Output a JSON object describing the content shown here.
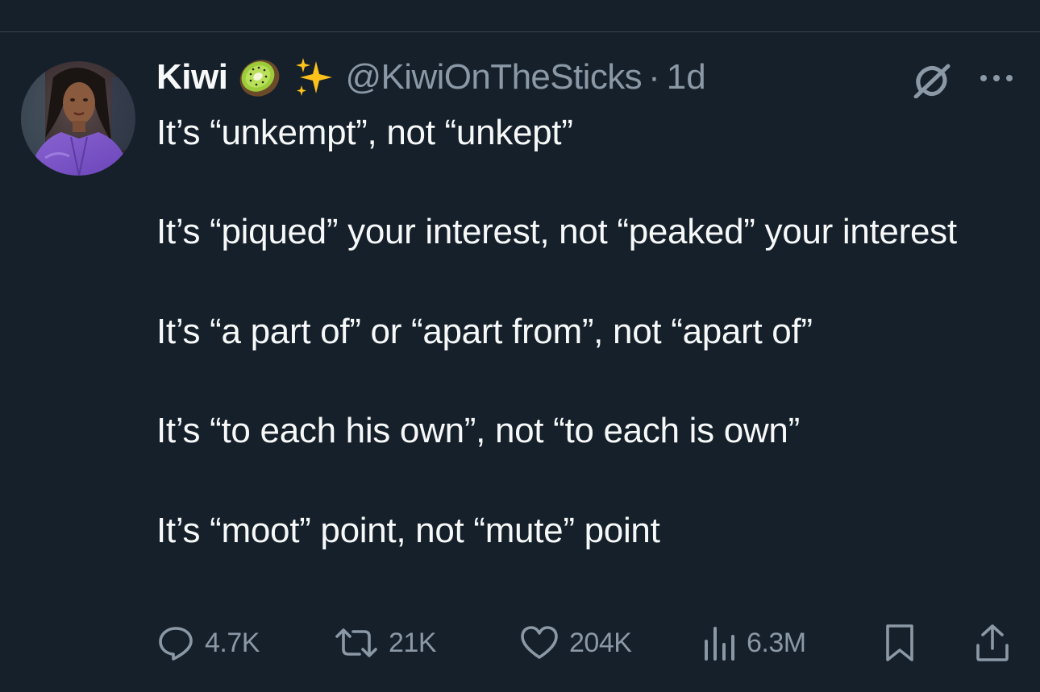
{
  "tweet": {
    "author": {
      "display_name": "Kiwi",
      "emojis": [
        "kiwi-emoji",
        "sparkles-emoji"
      ],
      "handle": "@KiwiOnTheSticks",
      "separator": "·",
      "time": "1d"
    },
    "paragraphs": [
      "It’s “unkempt”, not “unkept”",
      "It’s “piqued” your interest, not “peaked” your interest",
      "It’s “a part of” or “apart from”, not “apart of”",
      "It’s “to each his own”, not “to each is own”",
      "It’s “moot” point, not “mute” point"
    ],
    "metrics": {
      "replies": "4.7K",
      "reposts": "21K",
      "likes": "204K",
      "views": "6.3M"
    }
  },
  "icons": {
    "grok": "grok-icon",
    "more": "more-icon",
    "reply": "reply-icon",
    "repost": "repost-icon",
    "like": "heart-icon",
    "views": "views-chart-icon",
    "bookmark": "bookmark-icon",
    "share": "share-icon"
  },
  "colors": {
    "background": "#15202b",
    "text": "#f7f9f9",
    "secondary_text": "#8b98a5",
    "divider": "#38444d"
  }
}
